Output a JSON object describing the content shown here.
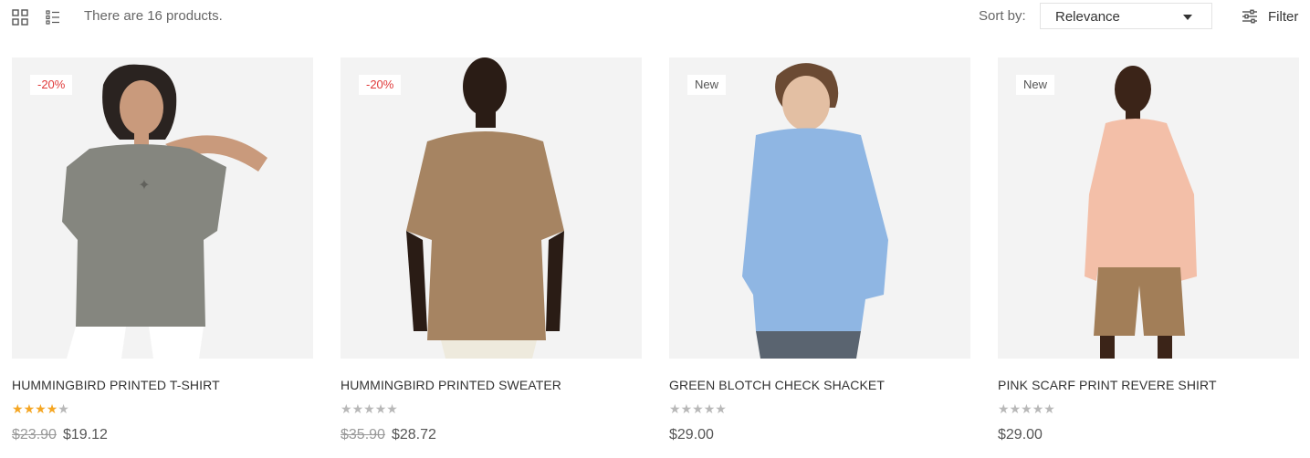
{
  "toolbar": {
    "count_text": "There are 16 products.",
    "sort_label": "Sort by:",
    "sort_value": "Relevance",
    "filter_label": "Filter"
  },
  "products": [
    {
      "badge": "-20%",
      "badge_type": "sale",
      "title": "HUMMINGBIRD PRINTED T-SHIRT",
      "rating": 4,
      "old_price": "$23.90",
      "price": "$19.12",
      "garment_color": "#85867f"
    },
    {
      "badge": "-20%",
      "badge_type": "sale",
      "title": "HUMMINGBIRD PRINTED SWEATER",
      "rating": 0,
      "old_price": "$35.90",
      "price": "$28.72",
      "garment_color": "#a68462"
    },
    {
      "badge": "New",
      "badge_type": "new",
      "title": "GREEN BLOTCH CHECK SHACKET",
      "rating": 0,
      "old_price": "",
      "price": "$29.00",
      "garment_color": "#8fb6e3"
    },
    {
      "badge": "New",
      "badge_type": "new",
      "title": "PINK SCARF PRINT REVERE SHIRT",
      "rating": 0,
      "old_price": "",
      "price": "$29.00",
      "garment_color": "#f3bfa8"
    }
  ],
  "colors": {
    "sale": "#e03a3a",
    "star_on": "#f5a623",
    "star_off": "#b8b8b8"
  }
}
